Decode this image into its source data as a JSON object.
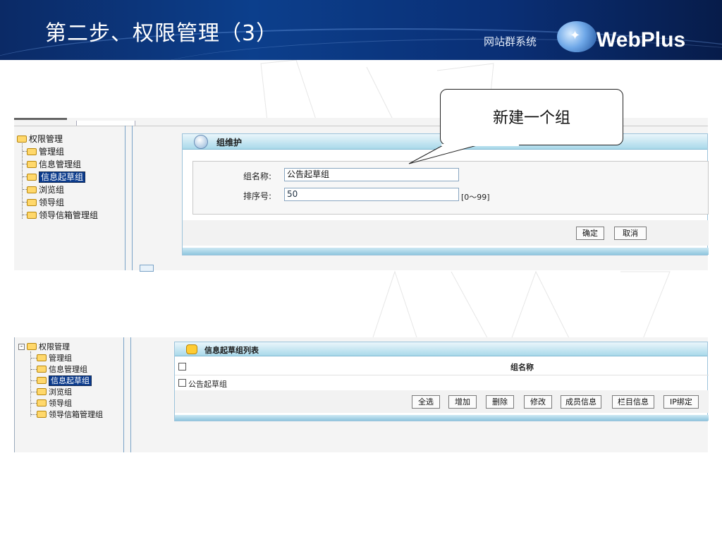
{
  "slide": {
    "title": "第二步、权限管理（3）",
    "brand_sub": "网站群系统",
    "brand_logo": "WebPlus",
    "brand_icon": "globe-icon",
    "callout": "新建一个组"
  },
  "panel1": {
    "tree": {
      "root": "权限管理",
      "items": [
        "管理组",
        "信息管理组",
        "信息起草组",
        "浏览组",
        "领导组",
        "领导信箱管理组"
      ],
      "selected_index": 2
    },
    "form": {
      "title": "组维护",
      "name_label": "组名称:",
      "name_value": "公告起草组",
      "order_label": "排序号:",
      "order_value": "50",
      "order_hint": "[0～99]",
      "ok": "确定",
      "cancel": "取消"
    }
  },
  "panel2": {
    "tree": {
      "root": "权限管理",
      "items": [
        "管理组",
        "信息管理组",
        "信息起草组",
        "浏览组",
        "领导组",
        "领导信箱管理组"
      ],
      "selected_index": 2
    },
    "list": {
      "title": "信息起草组列表",
      "column": "组名称",
      "rows": [
        "公告起草组"
      ],
      "buttons": [
        "全选",
        "增加",
        "删除",
        "修改",
        "成员信息",
        "栏目信息",
        "IP绑定"
      ]
    }
  },
  "colors": {
    "header_bg": "#0c3f8c",
    "selected": "#0a3a8c",
    "box_head": "#a9d9ea"
  }
}
